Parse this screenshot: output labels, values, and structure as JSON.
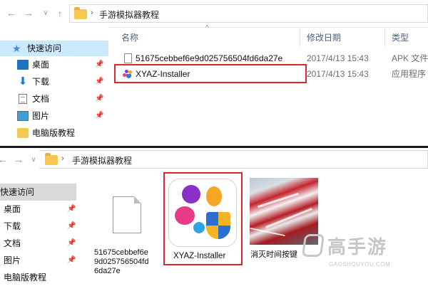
{
  "top_window": {
    "nav_buttons": {
      "back": "←",
      "forward": "→",
      "recent": "∨",
      "up": "↑"
    },
    "breadcrumb": {
      "separator": "›",
      "folder": "手游模拟器教程"
    },
    "sidebar": {
      "quick_access": "快速访问",
      "items": [
        {
          "label": "桌面",
          "pinned": true
        },
        {
          "label": "下载",
          "pinned": true
        },
        {
          "label": "文档",
          "pinned": true
        },
        {
          "label": "图片",
          "pinned": true
        },
        {
          "label": "电脑版教程",
          "pinned": false
        }
      ],
      "pin_glyph": "📌"
    },
    "columns": {
      "name": "名称",
      "modified": "修改日期",
      "type": "类型",
      "sort_glyph": "^"
    },
    "files": [
      {
        "name": "51675cebbef6e9d025756504fd6da27e",
        "date": "2017/4/13 15:43",
        "type": "APK 文件"
      },
      {
        "name": "XYAZ-Installer",
        "date": "2017/4/13 15:43",
        "type": "应用程序"
      }
    ]
  },
  "bottom_window": {
    "nav_buttons": {
      "back": "←",
      "forward": "→",
      "recent": "∨",
      "up": "↑"
    },
    "breadcrumb": {
      "separator": "›",
      "folder": "手游模拟器教程"
    },
    "sidebar": {
      "items": [
        {
          "label": "快速访问",
          "pinned": false,
          "active": true
        },
        {
          "label": "桌面",
          "pinned": true
        },
        {
          "label": "下载",
          "pinned": true
        },
        {
          "label": "文档",
          "pinned": true
        },
        {
          "label": "图片",
          "pinned": true
        },
        {
          "label": "电脑版教程",
          "pinned": false
        }
      ]
    },
    "tiles": [
      {
        "label_lines": [
          "51675cebbef6e",
          "9d025756504fd",
          "6da27e"
        ],
        "kind": "blank-file-icon"
      },
      {
        "label_lines": [
          "XYAZ-Installer"
        ],
        "kind": "xyaz-app-icon"
      },
      {
        "label_lines": [
          "消灭时间按键"
        ],
        "kind": "image-thumbnail"
      }
    ]
  },
  "watermark": {
    "brand": "高手游",
    "url": "GAOSHOUYOU.COM"
  },
  "colors": {
    "highlight": "#e0262a",
    "selection": "#cce8ff",
    "folder": "#f4c84e"
  }
}
